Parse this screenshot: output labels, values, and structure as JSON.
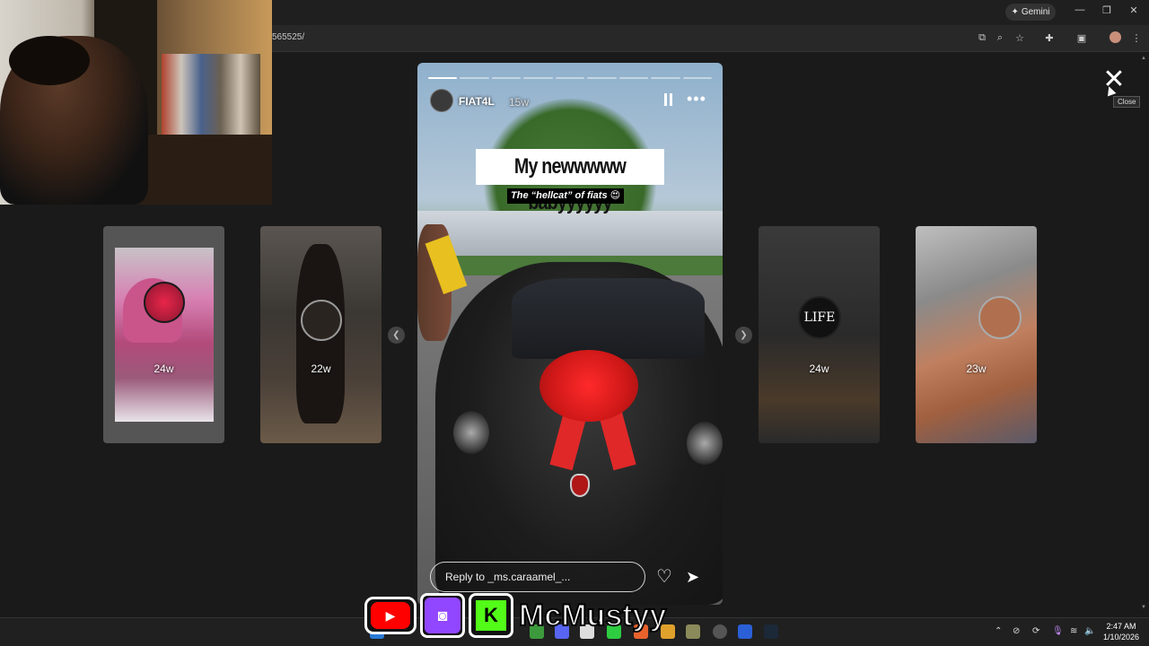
{
  "browser": {
    "url_fragment": "565525/",
    "gemini_label": "Gemini",
    "gemini_icon": "sparkle-icon",
    "window_controls": [
      "minimize-icon",
      "restore-icon",
      "close-icon"
    ],
    "toolbar_icons": [
      "install-app-icon",
      "zoom-icon",
      "bookmark-star-icon",
      "extensions-icon",
      "side-panel-icon",
      "profile-avatar",
      "kebab-menu-icon"
    ]
  },
  "stories": {
    "close_tooltip": "Close",
    "thumbnails": [
      {
        "name": "cake",
        "time": "24w"
      },
      {
        "name": "dog",
        "time": "22w"
      },
      {
        "name": "life",
        "time": "24w",
        "logo_text": "LIFE"
      },
      {
        "name": "nails",
        "time": "23w"
      }
    ],
    "active": {
      "username": "FIAT4L",
      "time": "15w",
      "caption": "My newwwww babyyyyyy",
      "subcaption": "The “hellcat” of fiats 😍",
      "reply_placeholder": "Reply to _ms.caraamel_...",
      "progress_segments": 9,
      "progress_done": 1
    },
    "nav_prev_icon": "chevron-left-icon",
    "nav_next_icon": "chevron-right-icon"
  },
  "stream_overlay": {
    "name": "McMustyy",
    "platforms": [
      "youtube-logo",
      "twitch-logo",
      "kick-logo"
    ]
  },
  "taskbar": {
    "time": "2:47 AM",
    "date": "1/10/2026",
    "tray_icons": [
      "chevron-up-icon",
      "no-notifications-icon",
      "sync-icon",
      "microphone-icon",
      "wifi-icon",
      "volume-icon"
    ]
  },
  "colors": {
    "background": "#1a1a1a",
    "twitch": "#9146ff",
    "youtube": "#ff0000",
    "kick": "#53fc18"
  }
}
